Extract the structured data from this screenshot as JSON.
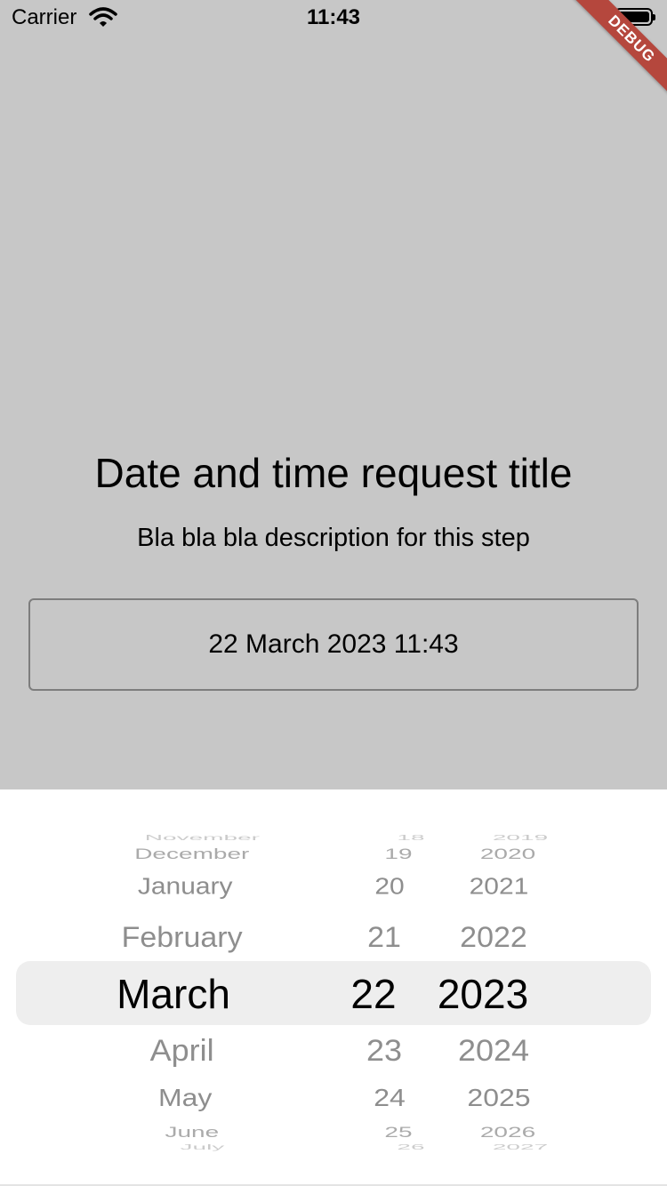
{
  "status_bar": {
    "carrier": "Carrier",
    "time": "11:43",
    "icons": [
      "wifi-icon",
      "battery-icon"
    ]
  },
  "debug_banner": "DEBUG",
  "step": {
    "title": "Date and time request title",
    "description": "Bla bla bla description for this step",
    "value": "22 March 2023 11:43"
  },
  "picker": {
    "months": [
      "November",
      "December",
      "January",
      "February",
      "March",
      "April",
      "May",
      "June",
      "July"
    ],
    "days": [
      "18",
      "19",
      "20",
      "21",
      "22",
      "23",
      "24",
      "25",
      "26"
    ],
    "years": [
      "2019",
      "2020",
      "2021",
      "2022",
      "2023",
      "2024",
      "2025",
      "2026",
      "2027"
    ],
    "selected": {
      "month": "March",
      "day": "22",
      "year": "2023"
    }
  },
  "colors": {
    "background": "#c7c7c7",
    "picker_background": "#ffffff",
    "selection_band": "#eeeeee",
    "debug_banner": "#b5473d",
    "unselected_text": "#8e8e8e"
  }
}
